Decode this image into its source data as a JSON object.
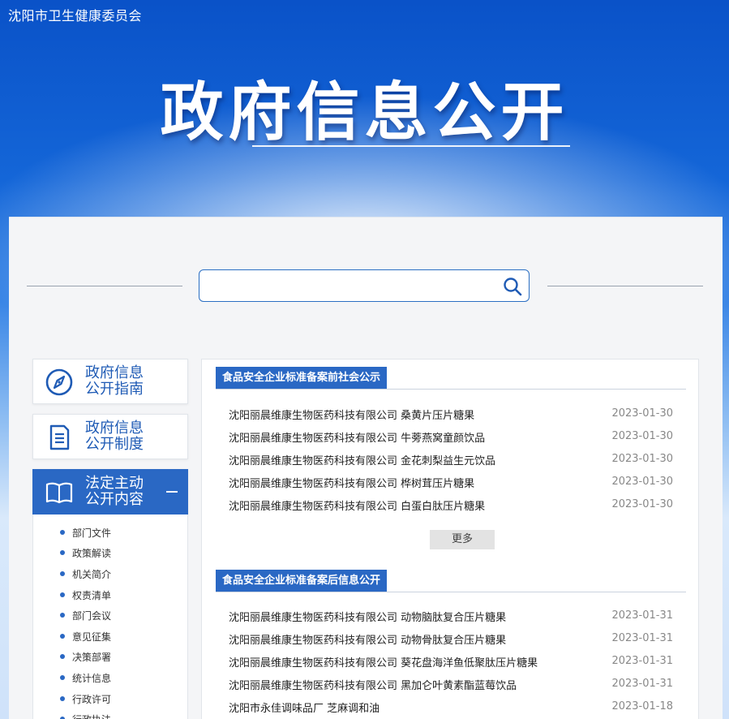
{
  "header": {
    "site_name": "沈阳市卫生健康委员会",
    "hero_title": "政府信息公开"
  },
  "search": {
    "placeholder": "",
    "value": ""
  },
  "sidebar": {
    "cards": [
      {
        "label_line1": "政府信息",
        "label_line2": "公开指南",
        "icon": "compass-icon"
      },
      {
        "label_line1": "政府信息",
        "label_line2": "公开制度",
        "icon": "document-icon"
      },
      {
        "label_line1": "法定主动",
        "label_line2": "公开内容",
        "icon": "book-icon"
      }
    ],
    "sub_items": [
      "部门文件",
      "政策解读",
      "机关简介",
      "权责清单",
      "部门会议",
      "意见征集",
      "决策部署",
      "统计信息",
      "行政许可",
      "行政执法"
    ]
  },
  "sections": [
    {
      "title": "食品安全企业标准备案前社会公示",
      "rows": [
        {
          "title": "沈阳丽晨维康生物医药科技有限公司  桑黄片压片糖果",
          "date": "2023-01-30"
        },
        {
          "title": "沈阳丽晨维康生物医药科技有限公司  牛蒡燕窝童颜饮品",
          "date": "2023-01-30"
        },
        {
          "title": "沈阳丽晨维康生物医药科技有限公司  金花刺梨益生元饮品",
          "date": "2023-01-30"
        },
        {
          "title": "沈阳丽晨维康生物医药科技有限公司  桦树茸压片糖果",
          "date": "2023-01-30"
        },
        {
          "title": "沈阳丽晨维康生物医药科技有限公司  白蛋白肽压片糖果",
          "date": "2023-01-30"
        }
      ],
      "more_label": "更多"
    },
    {
      "title": "食品安全企业标准备案后信息公开",
      "rows": [
        {
          "title": "沈阳丽晨维康生物医药科技有限公司  动物脑肽复合压片糖果",
          "date": "2023-01-31"
        },
        {
          "title": "沈阳丽晨维康生物医药科技有限公司  动物骨肽复合压片糖果",
          "date": "2023-01-31"
        },
        {
          "title": "沈阳丽晨维康生物医药科技有限公司  葵花盘海洋鱼低聚肽压片糖果",
          "date": "2023-01-31"
        },
        {
          "title": "沈阳丽晨维康生物医药科技有限公司  黑加仑叶黄素酯蓝莓饮品",
          "date": "2023-01-31"
        },
        {
          "title": "沈阳市永佳调味品厂  芝麻调和油",
          "date": "2023-01-18"
        }
      ]
    }
  ],
  "colors": {
    "primary": "#2a68c4",
    "banner_top": "#0a52c8",
    "panel_bg": "#f4f5f7"
  }
}
